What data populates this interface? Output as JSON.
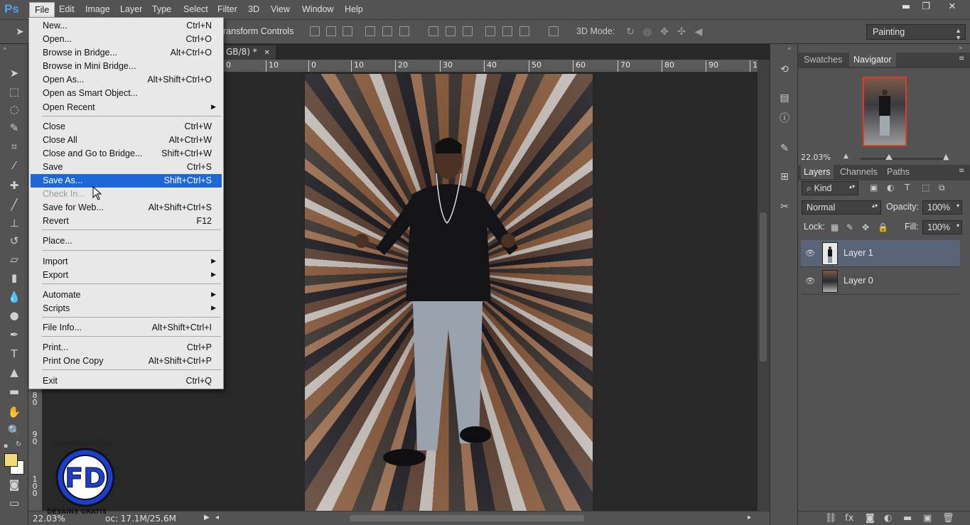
{
  "app": {
    "logo": "Ps"
  },
  "menubar": {
    "items": [
      "File",
      "Edit",
      "Image",
      "Layer",
      "Type",
      "Select",
      "Filter",
      "3D",
      "View",
      "Window",
      "Help"
    ]
  },
  "window_controls": {
    "minimize": "▬",
    "restore": "❐",
    "close": "✕"
  },
  "options": {
    "transform_controls": "ransform Controls",
    "mode_3d_label": "3D Mode:",
    "workspace": "Painting"
  },
  "document": {
    "tab_title": "GB/8) *",
    "tab_close": "✕",
    "ruler_h": [
      "0",
      "10",
      "0",
      "10",
      "20",
      "30",
      "40",
      "50",
      "60",
      "70",
      "80",
      "90",
      "1"
    ],
    "ruler_v": [
      [
        "8",
        "0"
      ],
      [
        "9",
        "0"
      ],
      [
        "1",
        "0",
        "0"
      ]
    ],
    "status_zoom": "22.03%",
    "status_doc": "oc: 17.1M/25.6M"
  },
  "watermark": {
    "top_text": "FRANSISKUS DEDI",
    "bottom_text": "DESAINS GRATIS"
  },
  "navigator": {
    "tabs": [
      "Swatches",
      "Navigator"
    ],
    "active_tab": "Navigator",
    "zoom": "22.03%"
  },
  "layers": {
    "tabs": [
      "Layers",
      "Channels",
      "Paths"
    ],
    "active_tab": "Layers",
    "filter_kind": "Kind",
    "blend_mode": "Normal",
    "opacity_label": "Opacity:",
    "opacity_value": "100%",
    "lock_label": "Lock:",
    "fill_label": "Fill:",
    "fill_value": "100%",
    "items": [
      {
        "name": "Layer 1",
        "selected": true
      },
      {
        "name": "Layer 0",
        "selected": false
      }
    ]
  },
  "file_menu": {
    "items": [
      {
        "label": "New...",
        "shortcut": "Ctrl+N"
      },
      {
        "label": "Open...",
        "shortcut": "Ctrl+O"
      },
      {
        "label": "Browse in Bridge...",
        "shortcut": "Alt+Ctrl+O"
      },
      {
        "label": "Browse in Mini Bridge...",
        "shortcut": ""
      },
      {
        "label": "Open As...",
        "shortcut": "Alt+Shift+Ctrl+O"
      },
      {
        "label": "Open as Smart Object...",
        "shortcut": ""
      },
      {
        "label": "Open Recent",
        "shortcut": "",
        "submenu": true
      },
      {
        "label": "Close",
        "shortcut": "Ctrl+W"
      },
      {
        "label": "Close All",
        "shortcut": "Alt+Ctrl+W"
      },
      {
        "label": "Close and Go to Bridge...",
        "shortcut": "Shift+Ctrl+W"
      },
      {
        "label": "Save",
        "shortcut": "Ctrl+S"
      },
      {
        "label": "Save As...",
        "shortcut": "Shift+Ctrl+S",
        "highlighted": true
      },
      {
        "label": "Check In...",
        "shortcut": "",
        "disabled": true
      },
      {
        "label": "Save for Web...",
        "shortcut": "Alt+Shift+Ctrl+S"
      },
      {
        "label": "Revert",
        "shortcut": "F12"
      },
      {
        "label": "Place...",
        "shortcut": ""
      },
      {
        "label": "Import",
        "shortcut": "",
        "submenu": true
      },
      {
        "label": "Export",
        "shortcut": "",
        "submenu": true
      },
      {
        "label": "Automate",
        "shortcut": "",
        "submenu": true
      },
      {
        "label": "Scripts",
        "shortcut": "",
        "submenu": true
      },
      {
        "label": "File Info...",
        "shortcut": "Alt+Shift+Ctrl+I"
      },
      {
        "label": "Print...",
        "shortcut": "Ctrl+P"
      },
      {
        "label": "Print One Copy",
        "shortcut": "Alt+Shift+Ctrl+P"
      },
      {
        "label": "Exit",
        "shortcut": "Ctrl+Q"
      }
    ]
  },
  "colors": {
    "menu_highlight": "#1e67d6",
    "foreground_swatch": "#f5d87c",
    "background_swatch": "#ffffff",
    "selected_layer": "#5a6478"
  }
}
